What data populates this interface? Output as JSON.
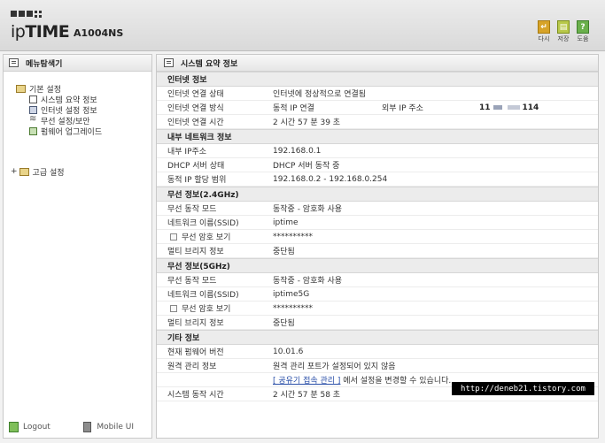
{
  "brand": {
    "prefix": "ip",
    "name": "TIME",
    "model": "A1004NS"
  },
  "top_actions": [
    {
      "label": "다시",
      "icon": "reload-icon"
    },
    {
      "label": "저장",
      "icon": "save-icon"
    },
    {
      "label": "도움",
      "icon": "help-icon"
    }
  ],
  "sidebar": {
    "title": "메뉴탐색기",
    "basic": "기본 설정",
    "items": [
      "시스템 요약 정보",
      "인터넷 설정 정보",
      "무선 설정/보안",
      "펌웨어 업그레이드"
    ],
    "advanced": "고급 설정",
    "logout": "Logout",
    "mobile": "Mobile UI"
  },
  "main": {
    "title": "시스템 요약 정보",
    "internet": {
      "title": "인터넷 정보",
      "status_label": "인터넷 연결 상태",
      "status_value": "인터넷에 정상적으로 연결됨",
      "method_label": "인터넷 연결 방식",
      "method_value": "동적 IP 연결",
      "ext_ip_label": "외부 IP 주소",
      "ext_ip_start": "11",
      "ext_ip_end": "114",
      "uptime_label": "인터넷 연결 시간",
      "uptime_value": "2 시간 57 분 39 초"
    },
    "lan": {
      "title": "내부 네트워크 정보",
      "ip_label": "내부 IP주소",
      "ip_value": "192.168.0.1",
      "dhcp_label": "DHCP 서버 상태",
      "dhcp_value": "DHCP 서버 동작 중",
      "range_label": "동적 IP 할당 범위",
      "range_value": "192.168.0.2 -  192.168.0.254"
    },
    "wifi24": {
      "title": "무선 정보(2.4GHz)",
      "mode_label": "무선 동작 모드",
      "mode_value": "동작중 - 암호화 사용",
      "ssid_label": "네트워크 이름(SSID)",
      "ssid_value": "iptime",
      "pw_label": "무선 암호 보기",
      "pw_value": "**********",
      "bridge_label": "멀티 브리지 정보",
      "bridge_value": "중단됨"
    },
    "wifi5": {
      "title": "무선 정보(5GHz)",
      "mode_label": "무선 동작 모드",
      "mode_value": "동작중 - 암호화 사용",
      "ssid_label": "네트워크 이름(SSID)",
      "ssid_value": "iptime5G",
      "pw_label": "무선 암호 보기",
      "pw_value": "**********",
      "bridge_label": "멀티 브리지 정보",
      "bridge_value": "중단됨"
    },
    "etc": {
      "title": "기타 정보",
      "fw_label": "현재 펌웨어 버전",
      "fw_value": "10.01.6",
      "remote_label": "원격 관리 정보",
      "remote_value": "원격 관리 포트가 설정되어 있지 않음",
      "remote_link": "[ 공유기 접속 관리 ]",
      "remote_note": " 에서 설정을 변경할 수 있습니다.",
      "sys_uptime_label": "시스템 동작 시간",
      "sys_uptime_value": "2 시간 57 분 58 초"
    }
  },
  "watermark": "http://deneb21.tistory.com"
}
